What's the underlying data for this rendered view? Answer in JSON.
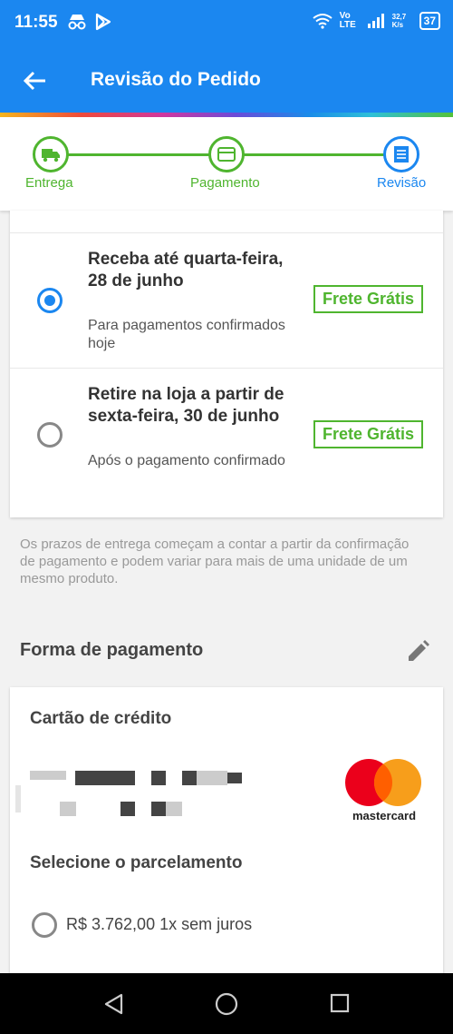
{
  "status_bar": {
    "time": "11:55",
    "network": "Vo LTE",
    "speed": "32,7 K/s",
    "battery": "37"
  },
  "header": {
    "title": "Revisão do Pedido"
  },
  "steps": [
    {
      "label": "Entrega",
      "icon": "truck-icon",
      "state": "done"
    },
    {
      "label": "Pagamento",
      "icon": "card-icon",
      "state": "done"
    },
    {
      "label": "Revisão",
      "icon": "document-icon",
      "state": "current"
    }
  ],
  "delivery_options": [
    {
      "title": "Receba até quarta-feira, 28 de junho",
      "subtitle": "Para pagamentos confirmados hoje",
      "badge": "Frete Grátis",
      "selected": true
    },
    {
      "title": "Retire na loja a partir de sexta-feira, 30 de junho",
      "subtitle": "Após o pagamento confirmado",
      "badge": "Frete Grátis",
      "selected": false
    }
  ],
  "delivery_note": "Os prazos de entrega começam a contar a partir da confirmação de pagamento e podem variar para mais de uma unidade de um mesmo produto.",
  "payment": {
    "section_title": "Forma de pagamento",
    "method_title": "Cartão de crédito",
    "card_brand": "mastercard",
    "installments_title": "Selecione o parcelamento",
    "installments": [
      {
        "label": "R$ 3.762,00 1x sem juros",
        "selected": false
      }
    ]
  },
  "colors": {
    "primary": "#1b87f0",
    "success": "#4fb52f"
  }
}
